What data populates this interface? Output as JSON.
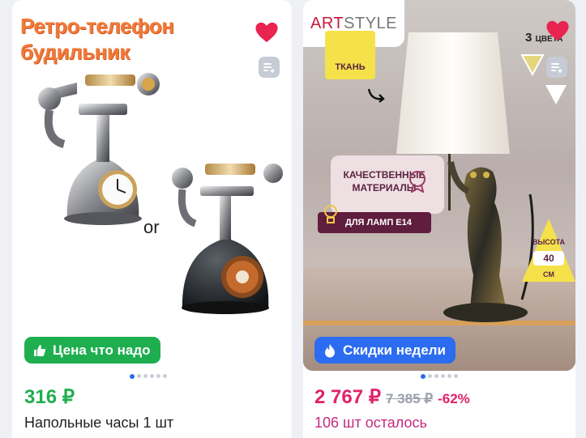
{
  "cards": [
    {
      "promo_line1": "Ретро-телефон",
      "promo_line2": "будильник",
      "image_caption": "or",
      "badge": {
        "label": "Цена что надо",
        "icon": "thumbs-up-icon",
        "color": "#1fae4f"
      },
      "carousel": {
        "count": 6,
        "active": 0
      },
      "price": "316 ₽",
      "title": "Напольные часы 1 шт",
      "favorited": true
    },
    {
      "brand": {
        "part1": "ART",
        "part2": "STYLE"
      },
      "colors_count": "3",
      "colors_word": "ЦВЕТА",
      "features": {
        "fabric": "ТКАНЬ",
        "quality_line1": "КАЧЕСТВЕННЫЕ",
        "quality_line2": "МАТЕРИАЛЫ",
        "lamp": "ДЛЯ ЛАМП Е14",
        "height_label": "ВЫСОТА",
        "height_value": "40",
        "height_unit": "СМ"
      },
      "badge": {
        "label": "Скидки недели",
        "icon": "flame-icon",
        "color": "#2b6cf0"
      },
      "carousel": {
        "count": 6,
        "active": 0
      },
      "price": "2 767 ₽",
      "old_price": "7 385 ₽",
      "discount": "-62%",
      "stock": "106 шт осталось",
      "favorited": true
    }
  ],
  "colors": {
    "green": "#1fae4f",
    "pink": "#e0226b",
    "blue": "#2b6cf0",
    "heart": "#e8244f"
  }
}
